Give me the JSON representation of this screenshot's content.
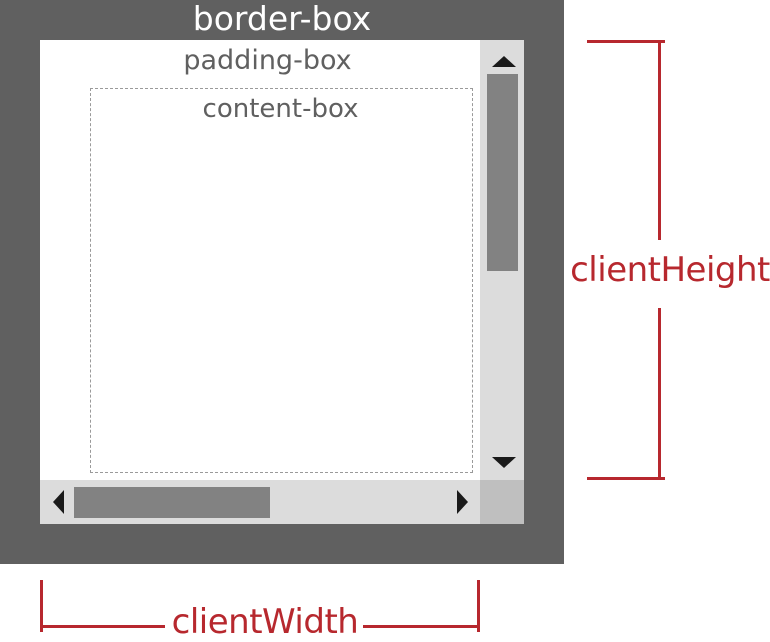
{
  "labels": {
    "border_box": "border-box",
    "padding_box": "padding-box",
    "content_box": "content-box",
    "client_height": "clientHeight",
    "client_width": "clientWidth"
  },
  "colors": {
    "border": "#606060",
    "scroll_track": "#dcdcdc",
    "scroll_thumb": "#828282",
    "measure": "#b7282e"
  }
}
